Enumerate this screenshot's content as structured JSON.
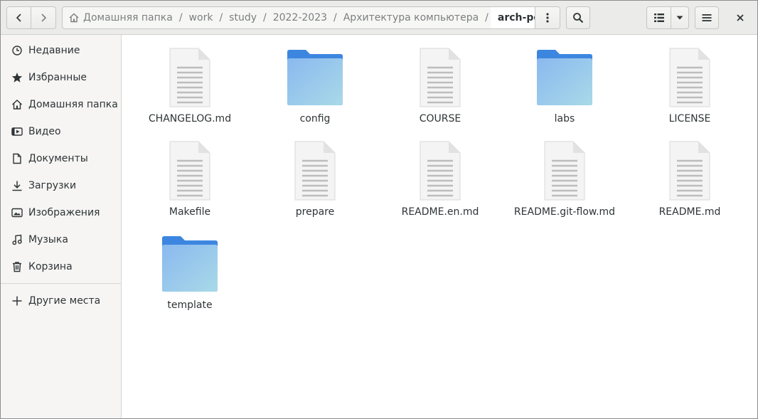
{
  "headerbar": {
    "breadcrumb": [
      {
        "label": "Домашняя папка"
      },
      {
        "label": "work"
      },
      {
        "label": "study"
      },
      {
        "label": "2022-2023"
      },
      {
        "label": "Архитектура компьютера"
      },
      {
        "label": "arch-pc"
      }
    ],
    "separator": "/",
    "icons": {
      "back": "chevron-left-icon",
      "forward": "chevron-right-icon",
      "home": "home-icon",
      "path_menu": "vertical-dots-icon",
      "search": "search-icon",
      "view_list": "list-view-icon",
      "view_options": "chevron-down-icon",
      "menu": "hamburger-icon",
      "close": "close-icon"
    }
  },
  "sidebar": {
    "items": [
      {
        "label": "Недавние",
        "icon": "clock-icon"
      },
      {
        "label": "Избранные",
        "icon": "star-icon"
      },
      {
        "label": "Домашняя папка",
        "icon": "home-icon"
      },
      {
        "label": "Видео",
        "icon": "video-icon"
      },
      {
        "label": "Документы",
        "icon": "document-icon"
      },
      {
        "label": "Загрузки",
        "icon": "download-icon"
      },
      {
        "label": "Изображения",
        "icon": "image-icon"
      },
      {
        "label": "Музыка",
        "icon": "music-icon"
      },
      {
        "label": "Корзина",
        "icon": "trash-icon"
      }
    ],
    "other_places": {
      "label": "Другие места",
      "icon": "plus-icon"
    }
  },
  "files": [
    {
      "name": "CHANGELOG.md",
      "type": "file"
    },
    {
      "name": "config",
      "type": "folder"
    },
    {
      "name": "COURSE",
      "type": "file"
    },
    {
      "name": "labs",
      "type": "folder"
    },
    {
      "name": "LICENSE",
      "type": "file"
    },
    {
      "name": "Makefile",
      "type": "file"
    },
    {
      "name": "prepare",
      "type": "file"
    },
    {
      "name": "README.en.md",
      "type": "file"
    },
    {
      "name": "README.git-flow.md",
      "type": "file"
    },
    {
      "name": "README.md",
      "type": "file"
    },
    {
      "name": "template",
      "type": "folder"
    }
  ],
  "colors": {
    "folder_top": "#3d86e0",
    "folder_body_start": "#8ab9ef",
    "folder_body_end": "#a9d9e8",
    "text": "#2e3436",
    "muted_text": "#7c7f80"
  }
}
